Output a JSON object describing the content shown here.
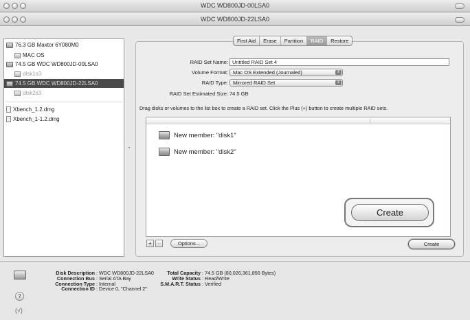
{
  "windows": {
    "back_title": "WDC WD800JD-00LSA0",
    "front_title": "WDC WD800JD-22LSA0"
  },
  "sidebar": {
    "items": [
      {
        "label": "76.3 GB Maxtor 6Y080M0",
        "icon": "drive-icon"
      },
      {
        "label": "MAC OS",
        "icon": "volume-icon"
      },
      {
        "label": "74.5 GB WDC WD800JD-00LSA0",
        "icon": "drive-icon"
      },
      {
        "label": "disk1s3",
        "icon": "volume-icon"
      },
      {
        "label": "74.5 GB WDC WD800JD-22LSA0",
        "icon": "drive-icon"
      },
      {
        "label": "disk2s3",
        "icon": "volume-icon"
      },
      {
        "label": "Xbench_1.2.dmg",
        "icon": "disk-image-icon"
      },
      {
        "label": "Xbench_1-1.2.dmg",
        "icon": "disk-image-icon"
      }
    ]
  },
  "tabs": [
    "First Aid",
    "Erase",
    "Partition",
    "RAID",
    "Restore"
  ],
  "active_tab": "RAID",
  "raid": {
    "set_name_label": "RAID Set Name:",
    "set_name_value": "Untitled RAID Set 4",
    "volume_format_label": "Volume Format:",
    "volume_format_value": "Mac OS Extended (Journaled)",
    "raid_type_label": "RAID Type:",
    "raid_type_value": "Mirrored RAID Set",
    "estimated_size_label": "RAID Set Estimated Size:",
    "estimated_size_value": "74.5 GB",
    "instructions": "Drag disks or volumes to the list box to create a RAID set. Click the Plus (+) button to create multiple RAID sets.",
    "members": [
      "New member: \"disk1\"",
      "New member: \"disk2\""
    ],
    "create_zoom_label": "Create",
    "add_button": "+",
    "remove_button": "−",
    "options_button": "Options...",
    "create_button": "Create"
  },
  "disk_info": {
    "left": [
      {
        "key": "Disk Description",
        "value": "WDC WD800JD-22LSA0"
      },
      {
        "key": "Connection Bus",
        "value": "Serial ATA Bay"
      },
      {
        "key": "Connection Type",
        "value": "Internal"
      },
      {
        "key": "Connection ID",
        "value": "Device 0, \"Channel 2\""
      }
    ],
    "right": [
      {
        "key": "Total Capacity",
        "value": "74.5 GB (80,026,361,856 Bytes)"
      },
      {
        "key": "Write Status",
        "value": "Read/Write"
      },
      {
        "key": "S.M.A.R.T. Status",
        "value": "Verified"
      }
    ]
  },
  "help_label": "?",
  "history_label": "(√)"
}
